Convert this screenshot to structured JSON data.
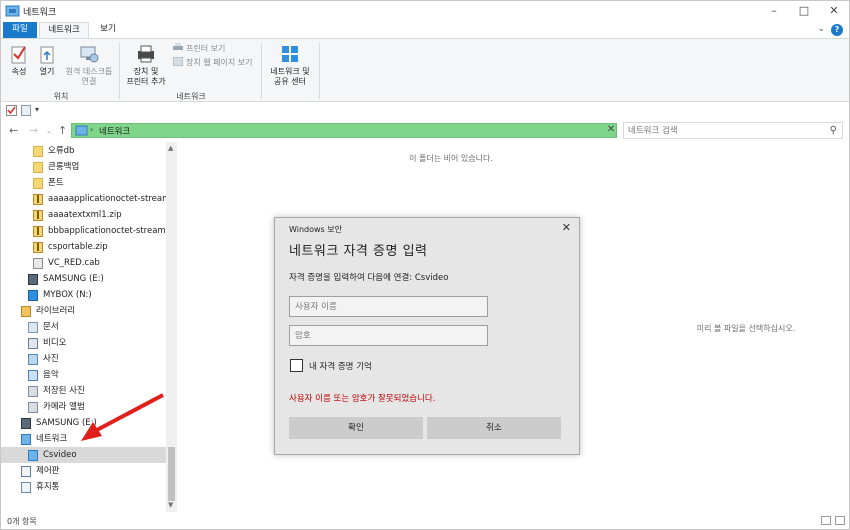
{
  "window": {
    "title": "네트워크",
    "controls": [
      "minimize",
      "maximize",
      "close"
    ]
  },
  "ribbon_tabs": [
    {
      "label": "파일",
      "active": false
    },
    {
      "label": "네트워크",
      "active": true
    },
    {
      "label": "보기",
      "active": false
    }
  ],
  "ribbon": {
    "location_group": {
      "label": "위치",
      "buttons": [
        {
          "label": "속성",
          "icon": "properties-icon"
        },
        {
          "label": "열기",
          "icon": "open-icon"
        },
        {
          "label_line1": "원격 데스크톱",
          "label_line2": "연결",
          "icon": "remote-desktop-icon"
        }
      ]
    },
    "network_group": {
      "label": "네트워크",
      "add_device": {
        "label_line1": "장치 및",
        "label_line2": "프린터 추가",
        "icon": "add-device-icon"
      },
      "view_printers": {
        "label": "프린터 보기",
        "icon": "printer-icon"
      },
      "view_device_web": {
        "label": "장치 웹 페이지 보기",
        "icon": "web-page-icon"
      }
    },
    "network_center": {
      "label_line1": "네트워크 및",
      "label_line2": "공유 센터",
      "icon": "network-center-icon"
    }
  },
  "address_bar": {
    "crumb": "네트워크",
    "search_placeholder": "네트워크 검색"
  },
  "tree": [
    {
      "label": "오류db",
      "icon": "folder-icon",
      "indent": 2
    },
    {
      "label": "큰롱백업",
      "icon": "folder-icon",
      "indent": 2
    },
    {
      "label": "폰트",
      "icon": "folder-icon",
      "indent": 2
    },
    {
      "label": "aaaaapplicationoctet-stream2.zip",
      "icon": "zip-icon",
      "indent": 2
    },
    {
      "label": "aaaatextxml1.zip",
      "icon": "zip-icon",
      "indent": 2
    },
    {
      "label": "bbbapplicationoctet-stream2.zip",
      "icon": "zip-icon",
      "indent": 2
    },
    {
      "label": "csportable.zip",
      "icon": "zip-icon",
      "indent": 2
    },
    {
      "label": "VC_RED.cab",
      "icon": "cab-icon",
      "indent": 2
    },
    {
      "label": "SAMSUNG (E:)",
      "icon": "drive-icon",
      "indent": 1
    },
    {
      "label": "MYBOX (N:)",
      "icon": "disc-drive-icon",
      "indent": 1
    },
    {
      "label": "라이브러리",
      "icon": "library-icon",
      "indent": 0
    },
    {
      "label": "문서",
      "icon": "documents-icon",
      "indent": 1
    },
    {
      "label": "비디오",
      "icon": "video-icon",
      "indent": 1
    },
    {
      "label": "사진",
      "icon": "pictures-icon",
      "indent": 1
    },
    {
      "label": "음악",
      "icon": "music-icon",
      "indent": 1
    },
    {
      "label": "저장된 사진",
      "icon": "saved-pictures-icon",
      "indent": 1
    },
    {
      "label": "카메라 앨범",
      "icon": "camera-roll-icon",
      "indent": 1
    },
    {
      "label": "SAMSUNG (E:)",
      "icon": "drive-icon",
      "indent": 0
    },
    {
      "label": "네트워크",
      "icon": "network-icon",
      "indent": 0
    },
    {
      "label": "Csvideo",
      "icon": "computer-icon",
      "indent": 1,
      "selected": true
    },
    {
      "label": "제어판",
      "icon": "control-panel-icon",
      "indent": 0
    },
    {
      "label": "휴지통",
      "icon": "recycle-bin-icon",
      "indent": 0
    }
  ],
  "content": {
    "empty_message": "이 폴더는 비어 있습니다.",
    "preview_message": "미리 볼 파일을 선택하십시오."
  },
  "status_bar": {
    "item_count": "0개 항목"
  },
  "dialog": {
    "caption": "Windows 보안",
    "heading": "네트워크 자격 증명 입력",
    "description": "자격 증명을 입력하여 다음에 연결: Csvideo",
    "username_placeholder": "사용자 이름",
    "password_placeholder": "암호",
    "remember_label": "내 자격 증명 기억",
    "error_message": "사용자 이름 또는 암호가 잘못되었습니다.",
    "ok_label": "확인",
    "cancel_label": "취소"
  },
  "colors": {
    "accent_blue": "#1979ca",
    "address_bar_highlight": "#7fd68a",
    "error_red": "#c00000",
    "annotation_arrow": "#e0201a"
  }
}
